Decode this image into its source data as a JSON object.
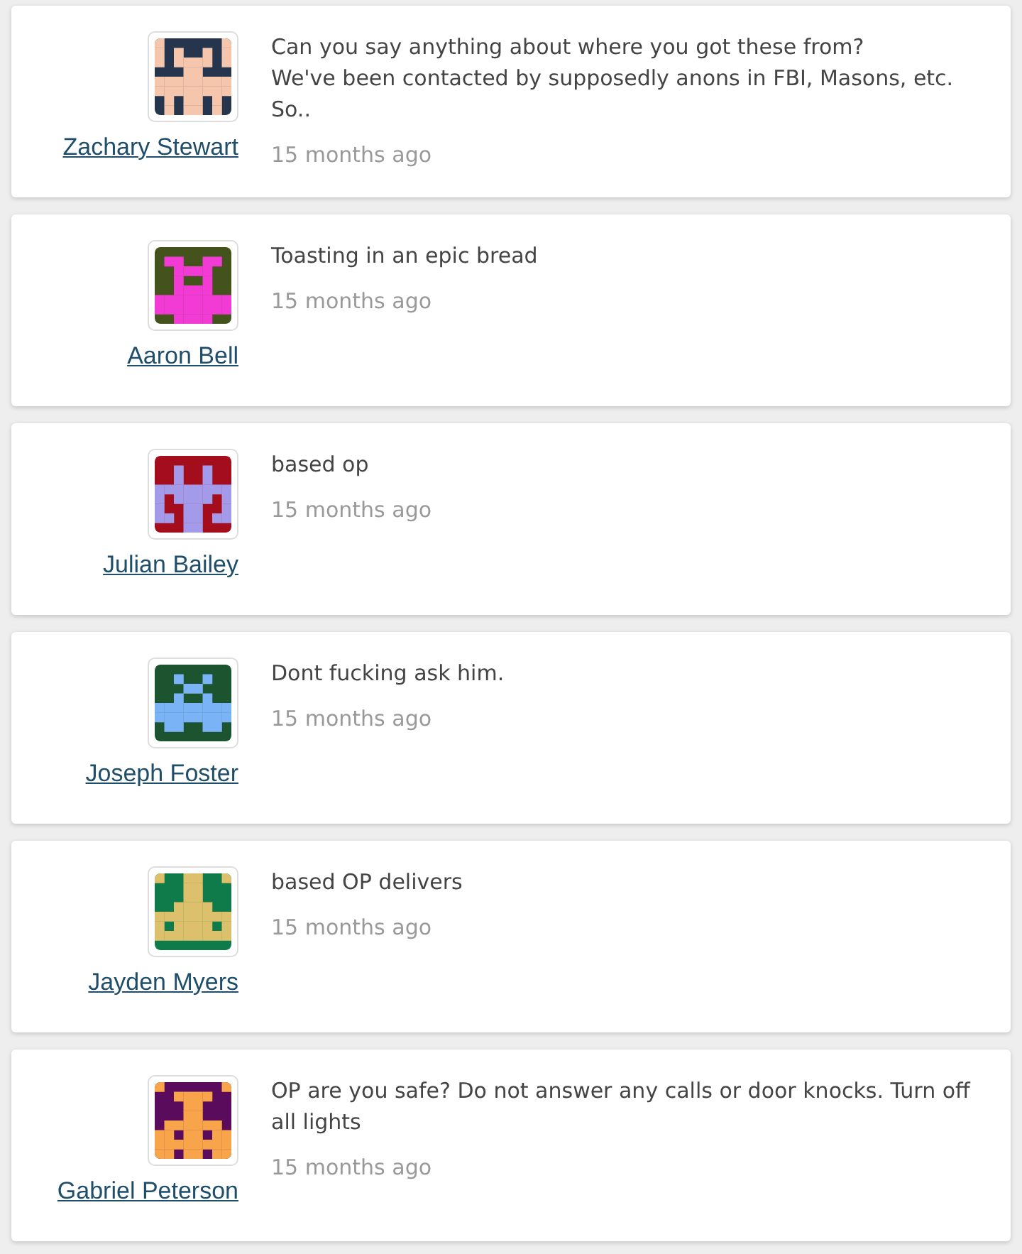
{
  "comments": [
    {
      "author": "Zachary Stewart",
      "text": "Can you say anything about where you got these from?\nWe've been contacted by supposedly anons in FBI, Masons, etc. So..",
      "time": "15 months ago"
    },
    {
      "author": "Aaron Bell",
      "text": "Toasting in an epic bread",
      "time": "15 months ago"
    },
    {
      "author": "Julian Bailey",
      "text": "based op",
      "time": "15 months ago"
    },
    {
      "author": "Joseph Foster",
      "text": "Dont fucking ask him.",
      "time": "15 months ago"
    },
    {
      "author": "Jayden Myers",
      "text": "based OP delivers",
      "time": "15 months ago"
    },
    {
      "author": "Gabriel Peterson",
      "text": "OP are you safe? Do not answer any calls or door knocks. Turn off all lights",
      "time": "15 months ago"
    }
  ]
}
